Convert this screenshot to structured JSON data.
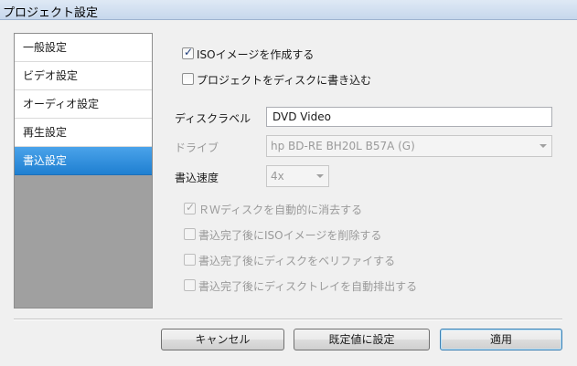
{
  "window": {
    "title": "プロジェクト設定"
  },
  "sidebar": {
    "items": [
      {
        "label": "一般設定"
      },
      {
        "label": "ビデオ設定"
      },
      {
        "label": "オーディオ設定"
      },
      {
        "label": "再生設定"
      },
      {
        "label": "書込設定",
        "selected": true
      }
    ]
  },
  "options": {
    "create_iso": {
      "label": "ISOイメージを作成する",
      "checked": true
    },
    "write_disc": {
      "label": "プロジェクトをディスクに書き込む",
      "checked": false
    }
  },
  "form": {
    "disc_label": {
      "label": "ディスクラベル",
      "value": "DVD Video"
    },
    "drive": {
      "label": "ドライブ",
      "value": "hp BD-RE  BH20L B57A (G)"
    },
    "speed": {
      "label": "書込速度",
      "value": "4x"
    }
  },
  "burn_options": [
    {
      "label": "ＲＷディスクを自動的に消去する",
      "checked": true
    },
    {
      "label": "書込完了後にISOイメージを削除する",
      "checked": false
    },
    {
      "label": "書込完了後にディスクをベリファイする",
      "checked": false
    },
    {
      "label": "書込完了後にディスクトレイを自動排出する",
      "checked": false
    }
  ],
  "buttons": {
    "cancel": "キャンセル",
    "default": "既定値に設定",
    "apply": "適用"
  }
}
